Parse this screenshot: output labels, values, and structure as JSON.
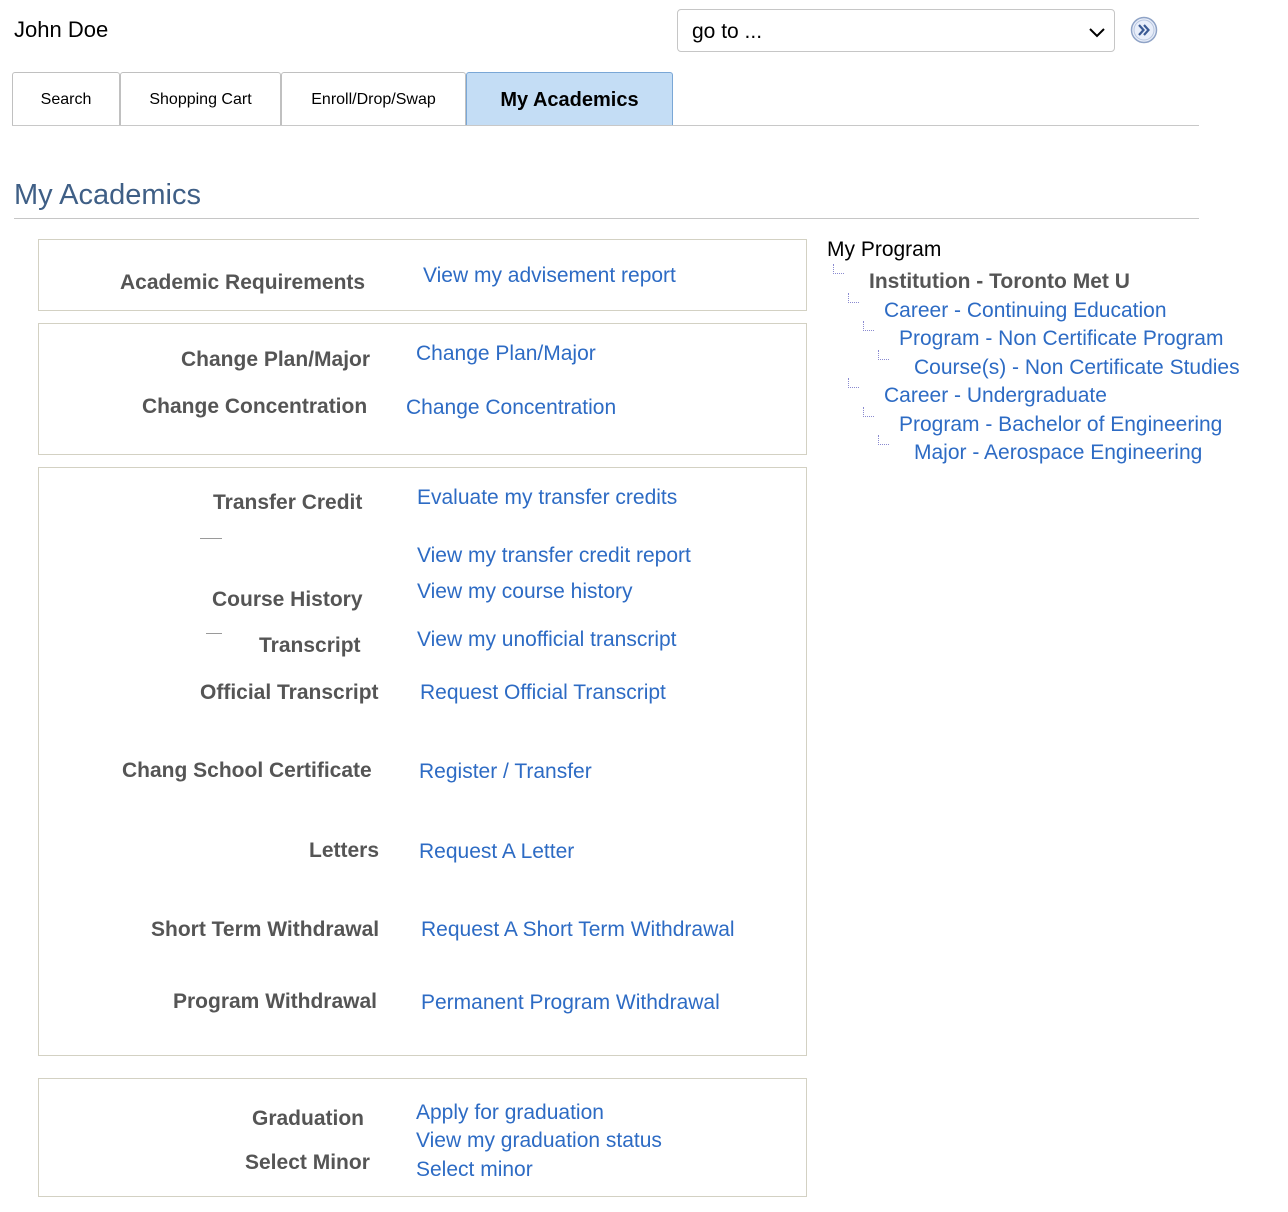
{
  "header": {
    "user_name": "John Doe",
    "goto_select_value": "go to ...",
    "go_button_icon": "double-chevron-right-icon"
  },
  "tabs": [
    {
      "label": "Search",
      "active": false
    },
    {
      "label": "Shopping Cart",
      "active": false
    },
    {
      "label": "Enroll/Drop/Swap",
      "active": false
    },
    {
      "label": "My Academics",
      "active": true
    }
  ],
  "page_title": "My Academics",
  "sections": {
    "requirements": {
      "academic_requirements_label": "Academic Requirements",
      "advisement_link": "View my advisement report"
    },
    "plan": {
      "change_plan_label": "Change Plan/Major",
      "change_plan_link": "Change Plan/Major",
      "change_concentration_label": "Change Concentration",
      "change_concentration_link": "Change Concentration"
    },
    "records": {
      "transfer_credit_label": "Transfer Credit",
      "evaluate_transfer_link": "Evaluate my transfer credits",
      "transfer_report_link": "View my transfer credit report",
      "course_history_label": "Course History",
      "course_history_link": "View my course history",
      "transcript_label": "Transcript",
      "unofficial_transcript_link": "View my unofficial transcript",
      "official_transcript_label": "Official Transcript",
      "official_transcript_link": "Request Official Transcript",
      "chang_certificate_label": "Chang School Certificate",
      "register_transfer_link": "Register / Transfer",
      "letters_label": "Letters",
      "letters_link": "Request A Letter",
      "short_term_label": "Short Term Withdrawal",
      "short_term_link": "Request A Short Term Withdrawal",
      "program_withdrawal_label": "Program Withdrawal",
      "program_withdrawal_link": "Permanent Program Withdrawal"
    },
    "graduation": {
      "graduation_label": "Graduation",
      "apply_graduation_link": "Apply for graduation",
      "graduation_status_link": "View my graduation status",
      "select_minor_label": "Select Minor",
      "select_minor_link": "Select minor"
    }
  },
  "my_program": {
    "heading": "My Program",
    "institution": "Institution - Toronto Met U",
    "career_1": "Career - Continuing Education",
    "program_1": "Program - Non Certificate Program",
    "course_1": "Course(s) - Non Certificate Studies",
    "career_2": "Career - Undergraduate",
    "program_2": "Program - Bachelor of Engineering",
    "major_2": "Major - Aerospace Engineering"
  },
  "colors": {
    "link": "#2d6bc4",
    "title": "#3f5f86",
    "active_tab": "#c4ddf5",
    "label": "#555555"
  }
}
